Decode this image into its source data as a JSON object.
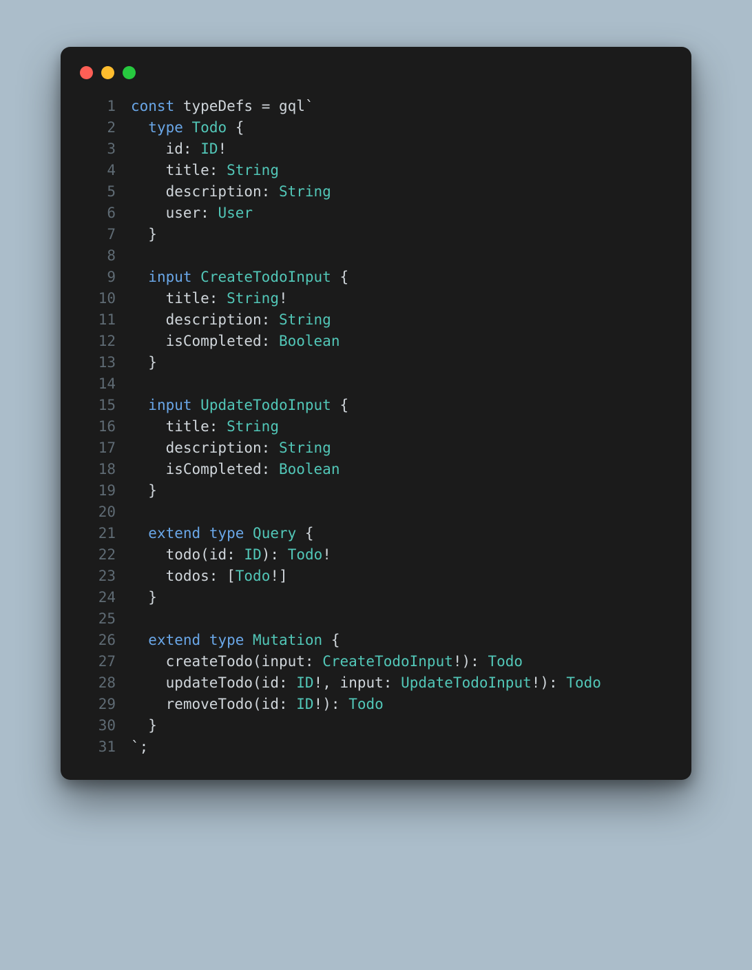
{
  "colors": {
    "bg_page": "#abbdca",
    "bg_window": "#1b1b1b",
    "dot_red": "#ff5f56",
    "dot_yellow": "#ffbd2e",
    "dot_green": "#27c93f",
    "gutter": "#5f6b74",
    "keyword": "#6aa7e8",
    "type": "#52c7b8",
    "plain": "#d0d6db"
  },
  "icons": {
    "close": "traffic-close",
    "minimize": "traffic-minimize",
    "zoom": "traffic-zoom"
  },
  "lines": [
    {
      "n": "1",
      "t": [
        [
          "kw",
          "const"
        ],
        [
          "plain",
          " "
        ],
        [
          "fn",
          "typeDefs"
        ],
        [
          "plain",
          " "
        ],
        [
          "op",
          "="
        ],
        [
          "plain",
          " "
        ],
        [
          "fn",
          "gql"
        ],
        [
          "str",
          "`"
        ]
      ]
    },
    {
      "n": "2",
      "t": [
        [
          "plain",
          "  "
        ],
        [
          "kw",
          "type"
        ],
        [
          "plain",
          " "
        ],
        [
          "type",
          "Todo"
        ],
        [
          "plain",
          " "
        ],
        [
          "brace",
          "{"
        ]
      ]
    },
    {
      "n": "3",
      "t": [
        [
          "plain",
          "    "
        ],
        [
          "field",
          "id"
        ],
        [
          "punc",
          ":"
        ],
        [
          "plain",
          " "
        ],
        [
          "type",
          "ID"
        ],
        [
          "op",
          "!"
        ]
      ]
    },
    {
      "n": "4",
      "t": [
        [
          "plain",
          "    "
        ],
        [
          "field",
          "title"
        ],
        [
          "punc",
          ":"
        ],
        [
          "plain",
          " "
        ],
        [
          "type",
          "String"
        ]
      ]
    },
    {
      "n": "5",
      "t": [
        [
          "plain",
          "    "
        ],
        [
          "field",
          "description"
        ],
        [
          "punc",
          ":"
        ],
        [
          "plain",
          " "
        ],
        [
          "type",
          "String"
        ]
      ]
    },
    {
      "n": "6",
      "t": [
        [
          "plain",
          "    "
        ],
        [
          "field",
          "user"
        ],
        [
          "punc",
          ":"
        ],
        [
          "plain",
          " "
        ],
        [
          "type",
          "User"
        ]
      ]
    },
    {
      "n": "7",
      "t": [
        [
          "plain",
          "  "
        ],
        [
          "brace",
          "}"
        ]
      ]
    },
    {
      "n": "8",
      "t": [
        [
          "plain",
          ""
        ]
      ]
    },
    {
      "n": "9",
      "t": [
        [
          "plain",
          "  "
        ],
        [
          "kw",
          "input"
        ],
        [
          "plain",
          " "
        ],
        [
          "type",
          "CreateTodoInput"
        ],
        [
          "plain",
          " "
        ],
        [
          "brace",
          "{"
        ]
      ]
    },
    {
      "n": "10",
      "t": [
        [
          "plain",
          "    "
        ],
        [
          "field",
          "title"
        ],
        [
          "punc",
          ":"
        ],
        [
          "plain",
          " "
        ],
        [
          "type",
          "String"
        ],
        [
          "op",
          "!"
        ]
      ]
    },
    {
      "n": "11",
      "t": [
        [
          "plain",
          "    "
        ],
        [
          "field",
          "description"
        ],
        [
          "punc",
          ":"
        ],
        [
          "plain",
          " "
        ],
        [
          "type",
          "String"
        ]
      ]
    },
    {
      "n": "12",
      "t": [
        [
          "plain",
          "    "
        ],
        [
          "field",
          "isCompleted"
        ],
        [
          "punc",
          ":"
        ],
        [
          "plain",
          " "
        ],
        [
          "type",
          "Boolean"
        ]
      ]
    },
    {
      "n": "13",
      "t": [
        [
          "plain",
          "  "
        ],
        [
          "brace",
          "}"
        ]
      ]
    },
    {
      "n": "14",
      "t": [
        [
          "plain",
          ""
        ]
      ]
    },
    {
      "n": "15",
      "t": [
        [
          "plain",
          "  "
        ],
        [
          "kw",
          "input"
        ],
        [
          "plain",
          " "
        ],
        [
          "type",
          "UpdateTodoInput"
        ],
        [
          "plain",
          " "
        ],
        [
          "brace",
          "{"
        ]
      ]
    },
    {
      "n": "16",
      "t": [
        [
          "plain",
          "    "
        ],
        [
          "field",
          "title"
        ],
        [
          "punc",
          ":"
        ],
        [
          "plain",
          " "
        ],
        [
          "type",
          "String"
        ]
      ]
    },
    {
      "n": "17",
      "t": [
        [
          "plain",
          "    "
        ],
        [
          "field",
          "description"
        ],
        [
          "punc",
          ":"
        ],
        [
          "plain",
          " "
        ],
        [
          "type",
          "String"
        ]
      ]
    },
    {
      "n": "18",
      "t": [
        [
          "plain",
          "    "
        ],
        [
          "field",
          "isCompleted"
        ],
        [
          "punc",
          ":"
        ],
        [
          "plain",
          " "
        ],
        [
          "type",
          "Boolean"
        ]
      ]
    },
    {
      "n": "19",
      "t": [
        [
          "plain",
          "  "
        ],
        [
          "brace",
          "}"
        ]
      ]
    },
    {
      "n": "20",
      "t": [
        [
          "plain",
          ""
        ]
      ]
    },
    {
      "n": "21",
      "t": [
        [
          "plain",
          "  "
        ],
        [
          "kw",
          "extend"
        ],
        [
          "plain",
          " "
        ],
        [
          "kw",
          "type"
        ],
        [
          "plain",
          " "
        ],
        [
          "type",
          "Query"
        ],
        [
          "plain",
          " "
        ],
        [
          "brace",
          "{"
        ]
      ]
    },
    {
      "n": "22",
      "t": [
        [
          "plain",
          "    "
        ],
        [
          "field",
          "todo"
        ],
        [
          "punc",
          "("
        ],
        [
          "field",
          "id"
        ],
        [
          "punc",
          ":"
        ],
        [
          "plain",
          " "
        ],
        [
          "type",
          "ID"
        ],
        [
          "punc",
          ")"
        ],
        [
          "punc",
          ":"
        ],
        [
          "plain",
          " "
        ],
        [
          "type",
          "Todo"
        ],
        [
          "op",
          "!"
        ]
      ]
    },
    {
      "n": "23",
      "t": [
        [
          "plain",
          "    "
        ],
        [
          "field",
          "todos"
        ],
        [
          "punc",
          ":"
        ],
        [
          "plain",
          " "
        ],
        [
          "punc",
          "["
        ],
        [
          "type",
          "Todo"
        ],
        [
          "op",
          "!"
        ],
        [
          "punc",
          "]"
        ]
      ]
    },
    {
      "n": "24",
      "t": [
        [
          "plain",
          "  "
        ],
        [
          "brace",
          "}"
        ]
      ]
    },
    {
      "n": "25",
      "t": [
        [
          "plain",
          ""
        ]
      ]
    },
    {
      "n": "26",
      "t": [
        [
          "plain",
          "  "
        ],
        [
          "kw",
          "extend"
        ],
        [
          "plain",
          " "
        ],
        [
          "kw",
          "type"
        ],
        [
          "plain",
          " "
        ],
        [
          "type",
          "Mutation"
        ],
        [
          "plain",
          " "
        ],
        [
          "brace",
          "{"
        ]
      ]
    },
    {
      "n": "27",
      "t": [
        [
          "plain",
          "    "
        ],
        [
          "field",
          "createTodo"
        ],
        [
          "punc",
          "("
        ],
        [
          "field",
          "input"
        ],
        [
          "punc",
          ":"
        ],
        [
          "plain",
          " "
        ],
        [
          "type",
          "CreateTodoInput"
        ],
        [
          "op",
          "!"
        ],
        [
          "punc",
          ")"
        ],
        [
          "punc",
          ":"
        ],
        [
          "plain",
          " "
        ],
        [
          "type",
          "Todo"
        ]
      ]
    },
    {
      "n": "28",
      "t": [
        [
          "plain",
          "    "
        ],
        [
          "field",
          "updateTodo"
        ],
        [
          "punc",
          "("
        ],
        [
          "field",
          "id"
        ],
        [
          "punc",
          ":"
        ],
        [
          "plain",
          " "
        ],
        [
          "type",
          "ID"
        ],
        [
          "op",
          "!"
        ],
        [
          "punc",
          ","
        ],
        [
          "plain",
          " "
        ],
        [
          "field",
          "input"
        ],
        [
          "punc",
          ":"
        ],
        [
          "plain",
          " "
        ],
        [
          "type",
          "UpdateTodoInput"
        ],
        [
          "op",
          "!"
        ],
        [
          "punc",
          ")"
        ],
        [
          "punc",
          ":"
        ],
        [
          "plain",
          " "
        ],
        [
          "type",
          "Todo"
        ]
      ]
    },
    {
      "n": "29",
      "t": [
        [
          "plain",
          "    "
        ],
        [
          "field",
          "removeTodo"
        ],
        [
          "punc",
          "("
        ],
        [
          "field",
          "id"
        ],
        [
          "punc",
          ":"
        ],
        [
          "plain",
          " "
        ],
        [
          "type",
          "ID"
        ],
        [
          "op",
          "!"
        ],
        [
          "punc",
          ")"
        ],
        [
          "punc",
          ":"
        ],
        [
          "plain",
          " "
        ],
        [
          "type",
          "Todo"
        ]
      ]
    },
    {
      "n": "30",
      "t": [
        [
          "plain",
          "  "
        ],
        [
          "brace",
          "}"
        ]
      ]
    },
    {
      "n": "31",
      "t": [
        [
          "str",
          "`"
        ],
        [
          "punc",
          ";"
        ]
      ]
    }
  ]
}
